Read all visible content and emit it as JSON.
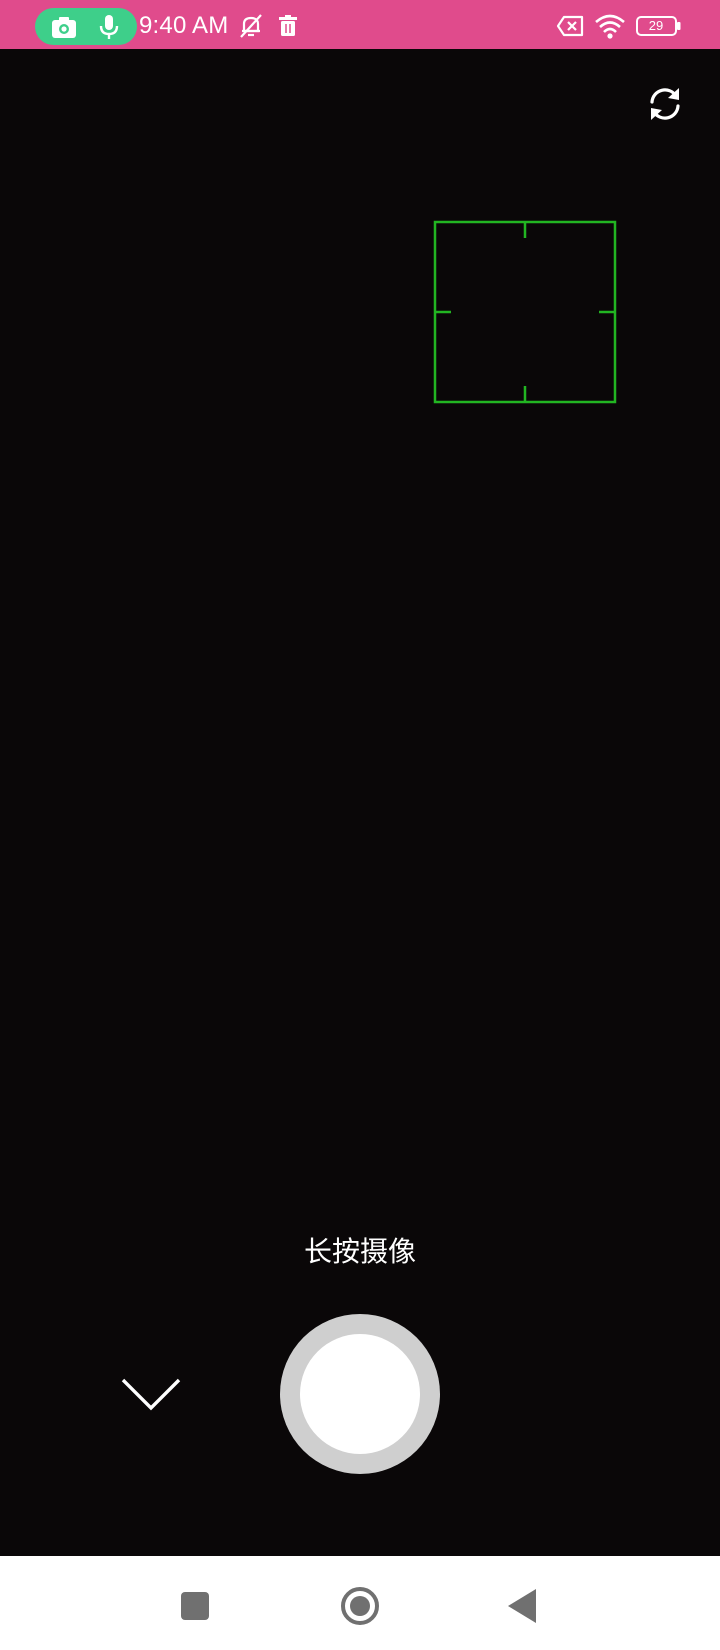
{
  "status_bar": {
    "time": "9:40 AM",
    "battery": "29",
    "background_color": "#e04b8c",
    "indicator_color": "#3ecf8a",
    "icons": [
      "camera-icon",
      "microphone-icon",
      "silent-bell-icon",
      "trash-icon",
      "sim-error-icon",
      "wifi-icon",
      "battery-icon"
    ]
  },
  "camera": {
    "hint": "长按摄像",
    "focus_color": "#22b522",
    "icons": [
      "switch-camera-icon",
      "chevron-down-icon"
    ],
    "shutter": "record-shutter"
  },
  "nav_bar": {
    "buttons": [
      "recents-button",
      "home-button",
      "back-button"
    ]
  }
}
